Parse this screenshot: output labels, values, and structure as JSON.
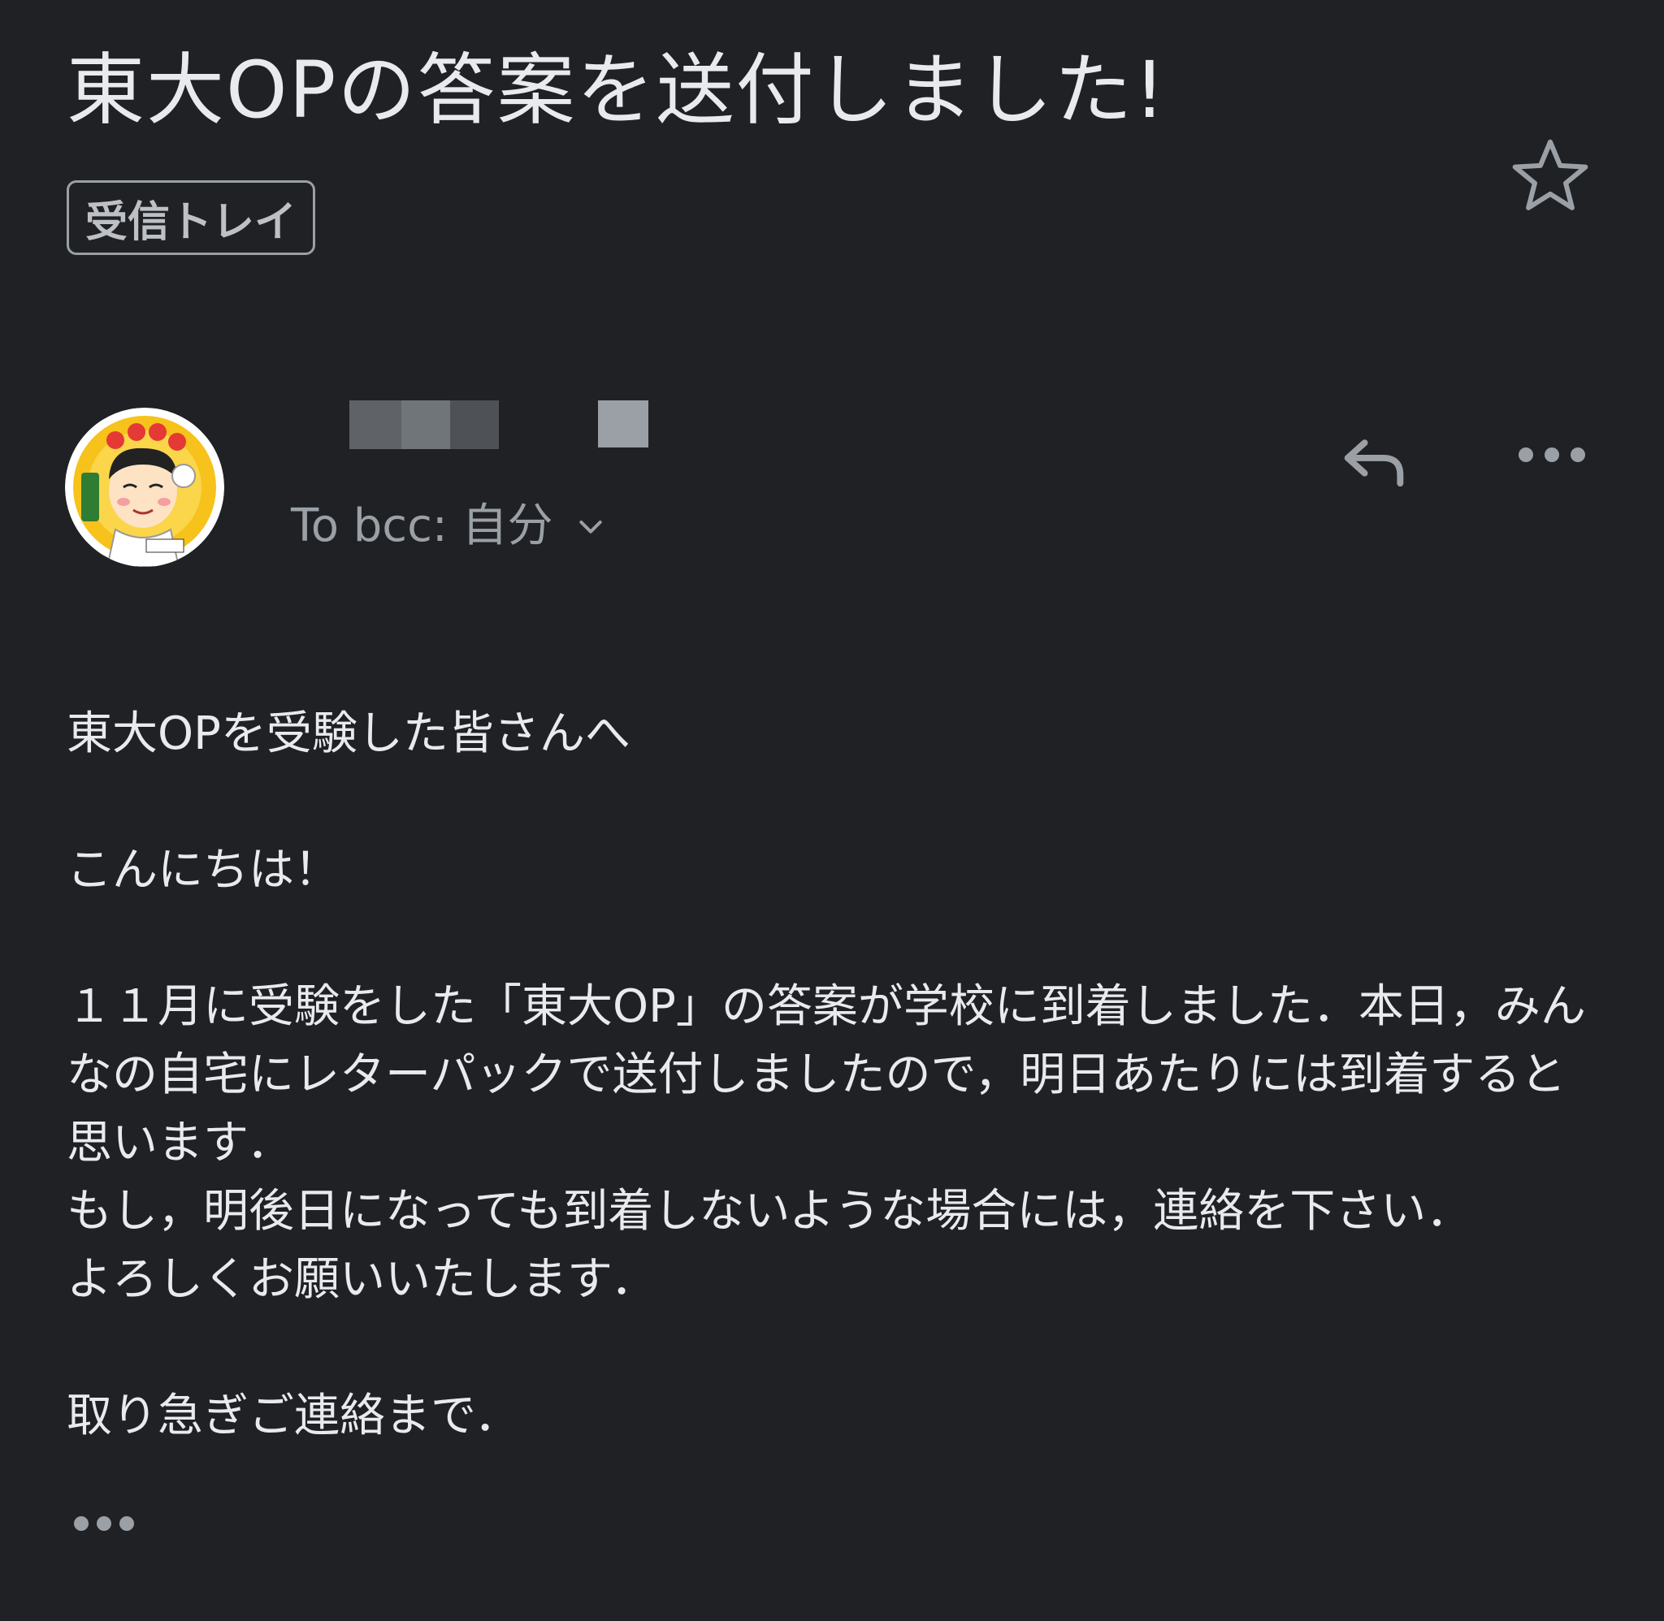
{
  "subject": "東大OPの答案を送付しました!",
  "label": "受信トレイ",
  "recipient": {
    "text": "To bcc: 自分"
  },
  "icons": {
    "star": "star-outline-icon",
    "reply": "reply-icon",
    "more": "more-horizontal-icon",
    "chevron": "chevron-down-icon",
    "trimmed": "trimmed-content-icon"
  },
  "colors": {
    "background": "#202124",
    "text": "#e8eaed",
    "secondary": "#9aa0a6"
  },
  "body": {
    "greeting": "東大OPを受験した皆さんへ",
    "hello": "こんにちは！",
    "paragraph": "１１月に受験をした「東大OP」の答案が学校に到着しました．本日，みんなの自宅にレターパックで送付しましたので，明日あたりには到着すると思います．",
    "line2": "もし，明後日になっても到着しないような場合には，連絡を下さい．",
    "line3": "よろしくお願いいたします．",
    "closing": "取り急ぎご連絡まで．"
  }
}
